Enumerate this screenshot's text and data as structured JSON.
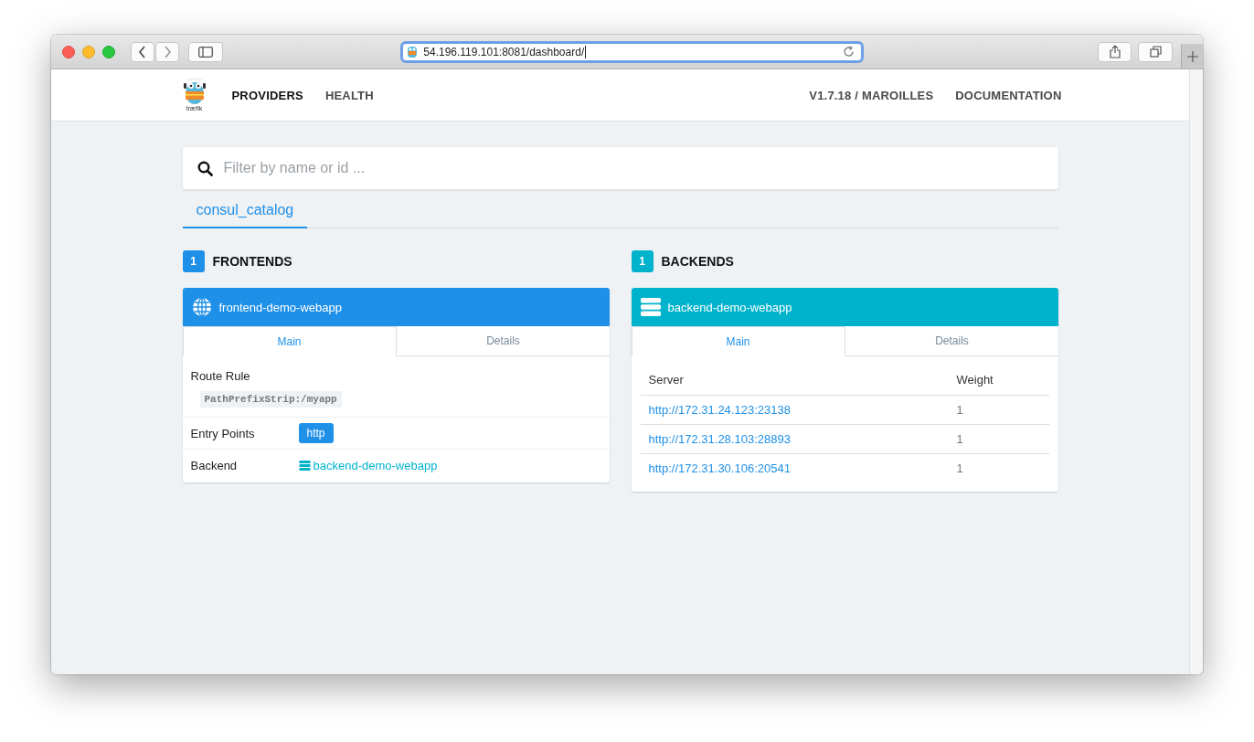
{
  "browser": {
    "url": "54.196.119.101:8081/dashboard/"
  },
  "navbar": {
    "logo_text": "træfik",
    "left_items": [
      {
        "label": "PROVIDERS",
        "selected": true
      },
      {
        "label": "HEALTH",
        "selected": false
      }
    ],
    "right_items": [
      {
        "label": "V1.7.18 / MAROILLES"
      },
      {
        "label": "DOCUMENTATION"
      }
    ]
  },
  "search": {
    "placeholder": "Filter by name or id ..."
  },
  "provider_tabs": [
    {
      "label": "consul_catalog",
      "selected": true
    }
  ],
  "frontends": {
    "count": "1",
    "title": "FRONTENDS",
    "items": [
      {
        "name": "frontend-demo-webapp",
        "tabs": [
          {
            "label": "Main",
            "selected": true
          },
          {
            "label": "Details",
            "selected": false
          }
        ],
        "route_rule_label": "Route Rule",
        "route_rule": "PathPrefixStrip:/myapp",
        "entry_points_label": "Entry Points",
        "entry_points": [
          "http"
        ],
        "backend_label": "Backend",
        "backend": "backend-demo-webapp"
      }
    ]
  },
  "backends": {
    "count": "1",
    "title": "BACKENDS",
    "items": [
      {
        "name": "backend-demo-webapp",
        "tabs": [
          {
            "label": "Main",
            "selected": true
          },
          {
            "label": "Details",
            "selected": false
          }
        ],
        "columns": [
          "Server",
          "Weight"
        ],
        "rows": [
          [
            "http://172.31.24.123:23138",
            "1"
          ],
          [
            "http://172.31.28.103:28893",
            "1"
          ],
          [
            "http://172.31.30.106:20541",
            "1"
          ]
        ]
      }
    ]
  }
}
